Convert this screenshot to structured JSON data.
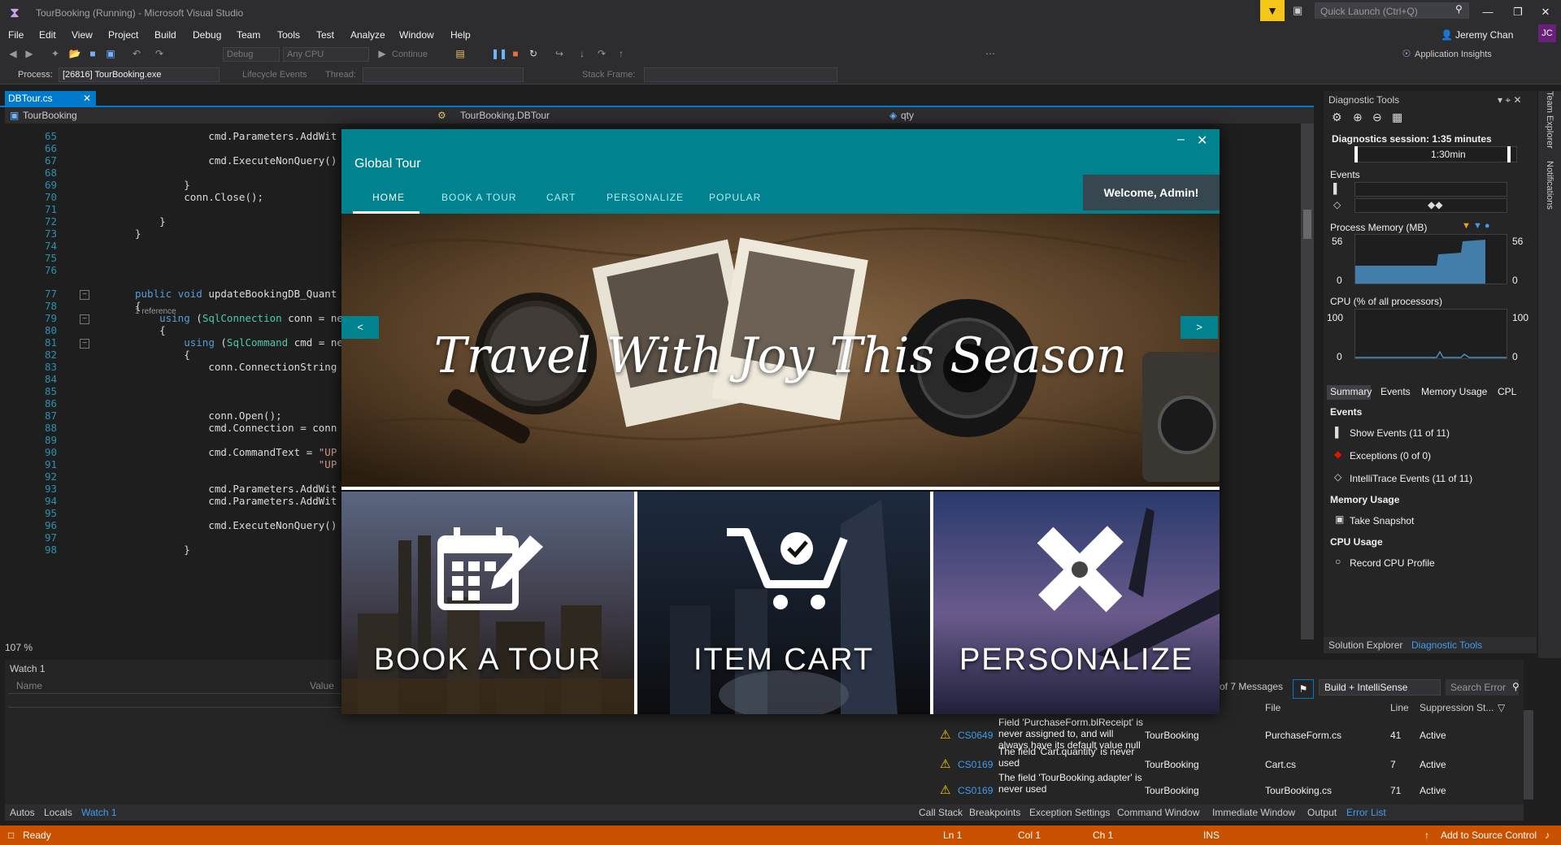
{
  "window": {
    "title": "TourBooking (Running) - Microsoft Visual Studio"
  },
  "quick_launch": {
    "placeholder": "Quick Launch (Ctrl+Q)"
  },
  "user": {
    "name": "Jeremy Chan",
    "initials": "JC"
  },
  "menu": [
    "File",
    "Edit",
    "View",
    "Project",
    "Build",
    "Debug",
    "Team",
    "Tools",
    "Test",
    "Analyze",
    "Window",
    "Help"
  ],
  "toolbar": {
    "config": "Debug",
    "platform": "Any CPU",
    "continue": "Continue",
    "app_insights": "Application Insights",
    "process_label": "Process:",
    "process_value": "[26816] TourBooking.exe",
    "lifecycle": "Lifecycle Events",
    "thread_label": "Thread:",
    "stack_label": "Stack Frame:"
  },
  "editor": {
    "tab": "DBTour.cs",
    "nav_project": "TourBooking",
    "nav_class": "TourBooking.DBTour",
    "nav_member": "qty",
    "zoom": "107 %",
    "reference_hint": "1 reference",
    "lines": [
      {
        "n": "65",
        "code": "            cmd.Parameters.AddWit"
      },
      {
        "n": "66",
        "code": ""
      },
      {
        "n": "67",
        "code": "            cmd.ExecuteNonQuery()"
      },
      {
        "n": "68",
        "code": ""
      },
      {
        "n": "69",
        "code": "        }"
      },
      {
        "n": "70",
        "code": "        conn.Close();"
      },
      {
        "n": "71",
        "code": ""
      },
      {
        "n": "72",
        "code": "    }"
      },
      {
        "n": "73",
        "code": "}"
      },
      {
        "n": "74",
        "code": ""
      },
      {
        "n": "75",
        "code": ""
      },
      {
        "n": "76",
        "code": ""
      },
      {
        "n": "77",
        "code": "public void updateBookingDB_Quant"
      },
      {
        "n": "78",
        "code": "{"
      },
      {
        "n": "79",
        "code": "    using (SqlConnection conn = ne"
      },
      {
        "n": "80",
        "code": "    {"
      },
      {
        "n": "81",
        "code": "        using (SqlCommand cmd = ne"
      },
      {
        "n": "82",
        "code": "        {"
      },
      {
        "n": "83",
        "code": "            conn.ConnectionString"
      },
      {
        "n": "84",
        "code": ""
      },
      {
        "n": "85",
        "code": ""
      },
      {
        "n": "86",
        "code": ""
      },
      {
        "n": "87",
        "code": "            conn.Open();"
      },
      {
        "n": "88",
        "code": "            cmd.Connection = conn"
      },
      {
        "n": "89",
        "code": ""
      },
      {
        "n": "90",
        "code": "            cmd.CommandText = \"UP"
      },
      {
        "n": "91",
        "code": "                              \"UP"
      },
      {
        "n": "92",
        "code": ""
      },
      {
        "n": "93",
        "code": "            cmd.Parameters.AddWit"
      },
      {
        "n": "94",
        "code": "            cmd.Parameters.AddWit"
      },
      {
        "n": "95",
        "code": ""
      },
      {
        "n": "96",
        "code": "            cmd.ExecuteNonQuery()"
      },
      {
        "n": "97",
        "code": ""
      },
      {
        "n": "98",
        "code": "        }"
      }
    ]
  },
  "watch": {
    "title": "Watch 1",
    "col_name": "Name",
    "col_value": "Value",
    "tabs": [
      "Autos",
      "Locals",
      "Watch 1"
    ]
  },
  "error_list": {
    "count": "of 7 Messages",
    "scope": "Build + IntelliSense",
    "search_placeholder": "Search Error",
    "headers": [
      "File",
      "Line",
      "Suppression St..."
    ],
    "rows": [
      {
        "code": "CS0649",
        "desc": "Field 'PurchaseForm.blReceipt' is never assigned to, and will always have its default value null",
        "project": "TourBooking",
        "file": "PurchaseForm.cs",
        "line": "41",
        "state": "Active"
      },
      {
        "code": "CS0169",
        "desc": "The field 'Cart.quantity' is never used",
        "project": "TourBooking",
        "file": "Cart.cs",
        "line": "7",
        "state": "Active"
      },
      {
        "code": "CS0169",
        "desc": "The field 'TourBooking.adapter' is never used",
        "project": "TourBooking",
        "file": "TourBooking.cs",
        "line": "71",
        "state": "Active"
      }
    ],
    "tabs": [
      "Call Stack",
      "Breakpoints",
      "Exception Settings",
      "Command Window",
      "Immediate Window",
      "Output",
      "Error List"
    ]
  },
  "diagnostics": {
    "title": "Diagnostic Tools",
    "session": "Diagnostics session: 1:35 minutes",
    "timeline_marker": "1:30min",
    "events_label": "Events",
    "memory_label": "Process Memory (MB)",
    "memory_min": "0",
    "memory_max": "56",
    "cpu_label": "CPU (% of all processors)",
    "cpu_min": "0",
    "cpu_max": "100",
    "tabs": [
      "Summary",
      "Events",
      "Memory Usage",
      "CPL"
    ],
    "events_section": "Events",
    "show_events": "Show Events (11 of 11)",
    "exceptions": "Exceptions (0 of 0)",
    "intellitrace": "IntelliTrace Events (11 of 11)",
    "memory_section": "Memory Usage",
    "take_snapshot": "Take Snapshot",
    "cpu_section": "CPU Usage",
    "record_cpu": "Record CPU Profile",
    "bottom_tabs": [
      "Solution Explorer",
      "Diagnostic Tools"
    ],
    "side_tabs": [
      "Team Explorer",
      "Notifications"
    ]
  },
  "status": {
    "ready": "Ready",
    "ln": "Ln 1",
    "col": "Col 1",
    "ch": "Ch 1",
    "ins": "INS",
    "source_control": "Add to Source Control"
  },
  "app": {
    "title": "Global Tour",
    "nav": [
      "HOME",
      "BOOK A TOUR",
      "CART",
      "PERSONALIZE",
      "POPULAR"
    ],
    "welcome": "Welcome, Admin!",
    "hero_text": "Travel With Joy This Season",
    "prev": "<",
    "next": ">",
    "tiles": [
      "BOOK A TOUR",
      "ITEM CART",
      "PERSONALIZE"
    ],
    "accent": "#00838f"
  }
}
